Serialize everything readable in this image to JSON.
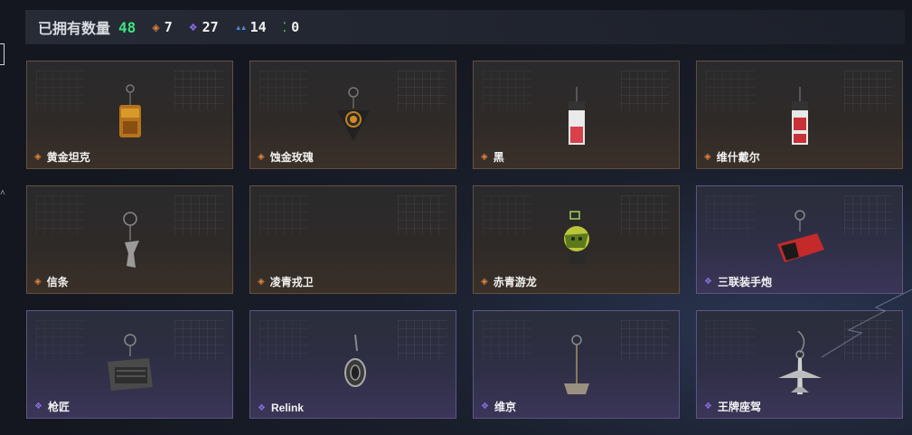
{
  "header": {
    "title": "已拥有数量",
    "total": "48",
    "stats": [
      {
        "icon": "orange-diamond-icon",
        "value": "7",
        "color": "#e0833d",
        "symbol": "◈"
      },
      {
        "icon": "purple-diamond-icon",
        "value": "27",
        "color": "#8b70e3",
        "symbol": "❖"
      },
      {
        "icon": "blue-rank-icon",
        "value": "14",
        "color": "#4a8ad8",
        "symbol": "▲▲"
      },
      {
        "icon": "green-dots-icon",
        "value": "0",
        "color": "#3ee27e",
        "symbol": "⁚"
      }
    ]
  },
  "items": [
    {
      "name": "黄金坦克",
      "rarity": "orange",
      "icon": "golden-tank-charm-icon"
    },
    {
      "name": "蚀金玫瑰",
      "rarity": "orange",
      "icon": "gold-rose-charm-icon"
    },
    {
      "name": "黑",
      "rarity": "orange",
      "icon": "black-tag-charm-icon"
    },
    {
      "name": "维什戴尔",
      "rarity": "orange",
      "icon": "wisadel-tag-charm-icon"
    },
    {
      "name": "信条",
      "rarity": "orange",
      "icon": "creed-charm-icon"
    },
    {
      "name": "凌青戎卫",
      "rarity": "orange",
      "icon": "empty-charm-icon"
    },
    {
      "name": "赤青游龙",
      "rarity": "orange",
      "icon": "dragon-charm-icon"
    },
    {
      "name": "三联装手炮",
      "rarity": "purple",
      "icon": "triple-cannon-charm-icon"
    },
    {
      "name": "枪匠",
      "rarity": "purple",
      "icon": "gunsmith-charm-icon"
    },
    {
      "name": "Relink",
      "rarity": "purple",
      "icon": "relink-charm-icon"
    },
    {
      "name": "维京",
      "rarity": "purple",
      "icon": "viking-axe-charm-icon"
    },
    {
      "name": "王牌座驾",
      "rarity": "purple",
      "icon": "ace-jet-charm-icon"
    }
  ]
}
